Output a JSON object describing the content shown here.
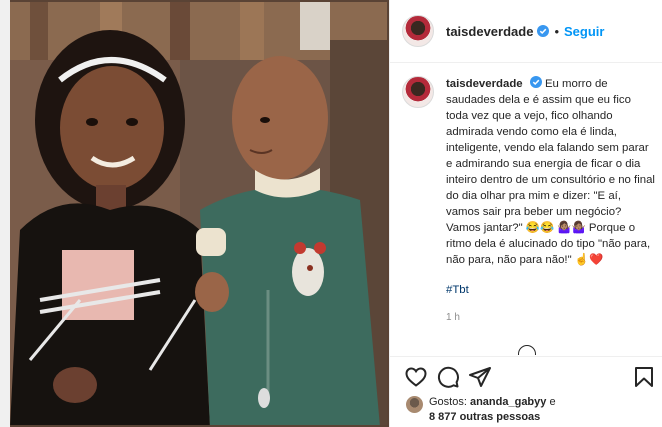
{
  "post": {
    "username": "taisdeverdade",
    "follow_label": "Seguir",
    "separator": "•",
    "caption": "Eu morro de saudades dela e é assim que eu fico toda vez que a vejo, fico olhando admirada vendo como ela é linda, inteligente, vendo ela falando sem parar e admirando sua energia de ficar o dia inteiro dentro de um consultório e no final do dia olhar pra mim e dizer: \"E aí, vamos sair pra beber um negócio? Vamos jantar?\" 😂😂 🤷🏽‍♀️🤷🏽‍♀️ Porque o ritmo dela é alucinado do tipo \"não para, não para, não para não!\" ☝️❤️",
    "hashtag": "#Tbt",
    "time_ago": "1 h",
    "likes_prefix": "Gostos:",
    "liker": "ananda_gabyy",
    "likes_joiner": " e",
    "likes_rest": "8 877 outras pessoas"
  },
  "icons": {
    "verified": "verified-badge-icon",
    "like": "heart-icon",
    "comment": "comment-icon",
    "share": "paper-plane-icon",
    "save": "bookmark-icon"
  },
  "colors": {
    "accent": "#0095f6",
    "verified": "#3897f0",
    "hashtag": "#00376b",
    "muted": "#8e8e8e"
  }
}
